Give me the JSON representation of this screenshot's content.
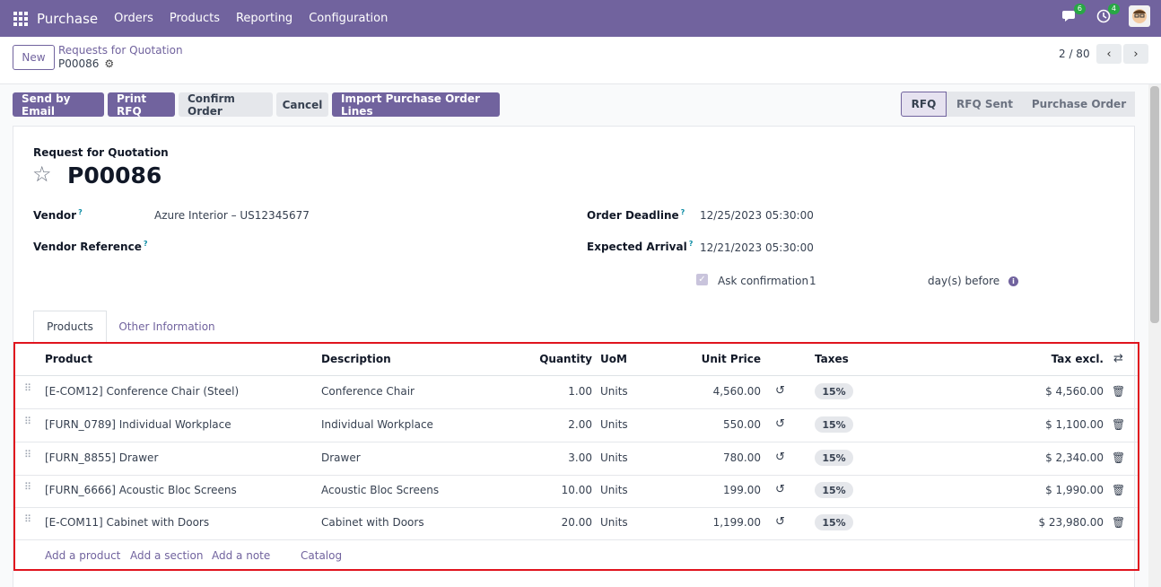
{
  "navbar": {
    "app": "Purchase",
    "menu": [
      "Orders",
      "Products",
      "Reporting",
      "Configuration"
    ],
    "messages_count": "6",
    "activities_count": "4"
  },
  "control_panel": {
    "new_label": "New",
    "breadcrumb": "Requests for Quotation",
    "record": "P00086",
    "pager": "2 / 80"
  },
  "actions": [
    "Send by Email",
    "Print RFQ",
    "Confirm Order",
    "Cancel",
    "Import Purchase Order Lines"
  ],
  "statusbar": [
    "RFQ",
    "RFQ Sent",
    "Purchase Order"
  ],
  "form": {
    "kicker": "Request for Quotation",
    "title": "P00086",
    "vendor_label": "Vendor",
    "vendor_value": "Azure Interior – US12345677",
    "vendor_ref_label": "Vendor Reference",
    "deadline_label": "Order Deadline",
    "deadline_value": "12/25/2023 05:30:00",
    "arrival_label": "Expected Arrival",
    "arrival_value": "12/21/2023 05:30:00",
    "ask_label": "Ask confirmation",
    "ask_days": "1",
    "ask_suffix": "day(s) before",
    "help_mark": "?"
  },
  "tabs": [
    "Products",
    "Other Information"
  ],
  "table": {
    "headers": {
      "product": "Product",
      "description": "Description",
      "quantity": "Quantity",
      "uom": "UoM",
      "unit_price": "Unit Price",
      "taxes": "Taxes",
      "tax_excl": "Tax excl."
    },
    "rows": [
      {
        "product": "[E-COM12] Conference Chair (Steel)",
        "description": "Conference Chair",
        "quantity": "1.00",
        "uom": "Units",
        "price": "4,560.00",
        "tax": "15%",
        "subtotal": "$ 4,560.00"
      },
      {
        "product": "[FURN_0789] Individual Workplace",
        "description": "Individual Workplace",
        "quantity": "2.00",
        "uom": "Units",
        "price": "550.00",
        "tax": "15%",
        "subtotal": "$ 1,100.00"
      },
      {
        "product": "[FURN_8855] Drawer",
        "description": "Drawer",
        "quantity": "3.00",
        "uom": "Units",
        "price": "780.00",
        "tax": "15%",
        "subtotal": "$ 2,340.00"
      },
      {
        "product": "[FURN_6666] Acoustic Bloc Screens",
        "description": "Acoustic Bloc Screens",
        "quantity": "10.00",
        "uom": "Units",
        "price": "199.00",
        "tax": "15%",
        "subtotal": "$ 1,990.00"
      },
      {
        "product": "[E-COM11] Cabinet with Doors",
        "description": "Cabinet with Doors",
        "quantity": "20.00",
        "uom": "Units",
        "price": "1,199.00",
        "tax": "15%",
        "subtotal": "$ 23,980.00"
      }
    ],
    "add_links": [
      "Add a product",
      "Add a section",
      "Add a note",
      "Catalog"
    ]
  },
  "colors": {
    "brand": "#71639e",
    "highlight": "#e0141e"
  }
}
